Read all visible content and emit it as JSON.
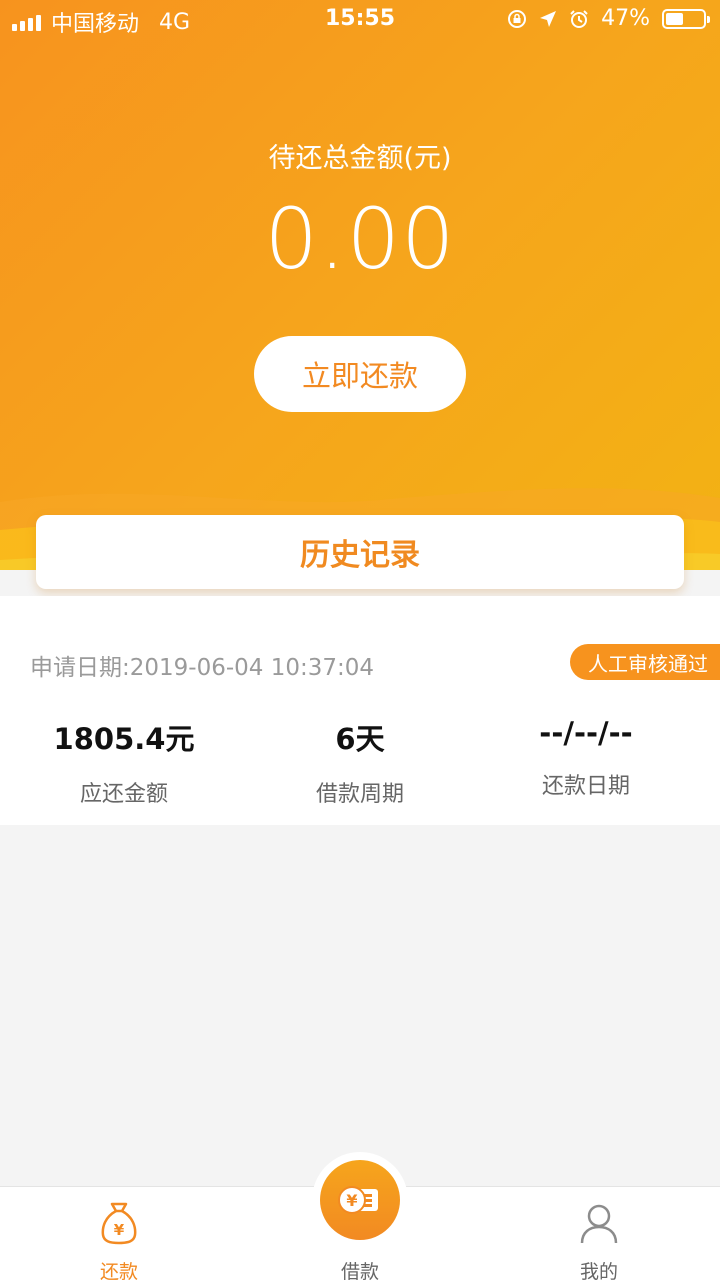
{
  "status_bar": {
    "carrier": "中国移动",
    "network": "4G",
    "time": "15:55",
    "battery": "47%",
    "battery_level": 0.47
  },
  "summary": {
    "label": "待还总金额(元)",
    "amount": "0.00",
    "repay_button": "立即还款"
  },
  "history": {
    "title": "历史记录"
  },
  "record": {
    "apply_date": "申请日期:2019-06-04 10:37:04",
    "status": "人工审核通过",
    "stats": [
      {
        "value": "1805.4元",
        "label": "应还金额"
      },
      {
        "value": "6天",
        "label": "借款周期"
      },
      {
        "value": "--/--/--",
        "label": "还款日期"
      }
    ]
  },
  "tabbar": {
    "tabs": [
      {
        "label": "还款",
        "icon": "money-bag-icon",
        "active": true
      },
      {
        "label": "借款",
        "icon": "coin-stack-icon",
        "active": false
      },
      {
        "label": "我的",
        "icon": "user-icon",
        "active": false
      }
    ]
  },
  "colors": {
    "accent": "#f28a22",
    "gradient_start": "#f7931e",
    "gradient_end": "#f2b313"
  }
}
